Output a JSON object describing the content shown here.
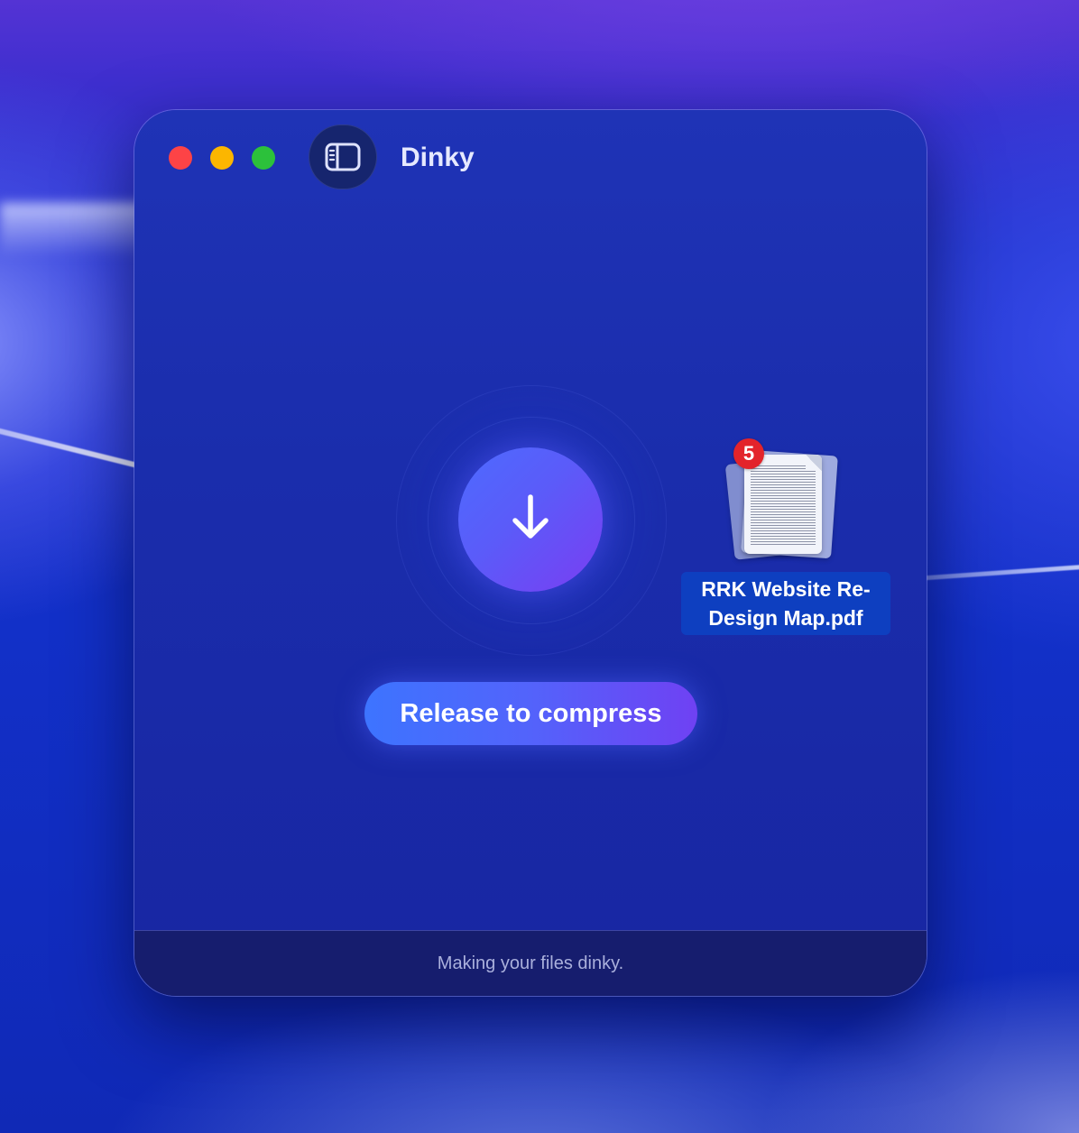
{
  "window": {
    "title": "Dinky",
    "traffic_lights": {
      "close_color": "#fd4346",
      "minimize_color": "#fcb600",
      "zoom_color": "#2cc13b"
    },
    "sidebar_toggle_icon": "sidebar-icon"
  },
  "drop_zone": {
    "icon": "arrow-down-icon",
    "button_label": "Release to compress"
  },
  "dragged_file": {
    "name": "RRK Website Re-Design Map.pdf",
    "count_badge": "5",
    "icon": "document-icon"
  },
  "footer": {
    "status": "Making your files dinky."
  },
  "colors": {
    "accent_start": "#3d74ff",
    "accent_end": "#6f41f3",
    "badge": "#e3242b"
  }
}
